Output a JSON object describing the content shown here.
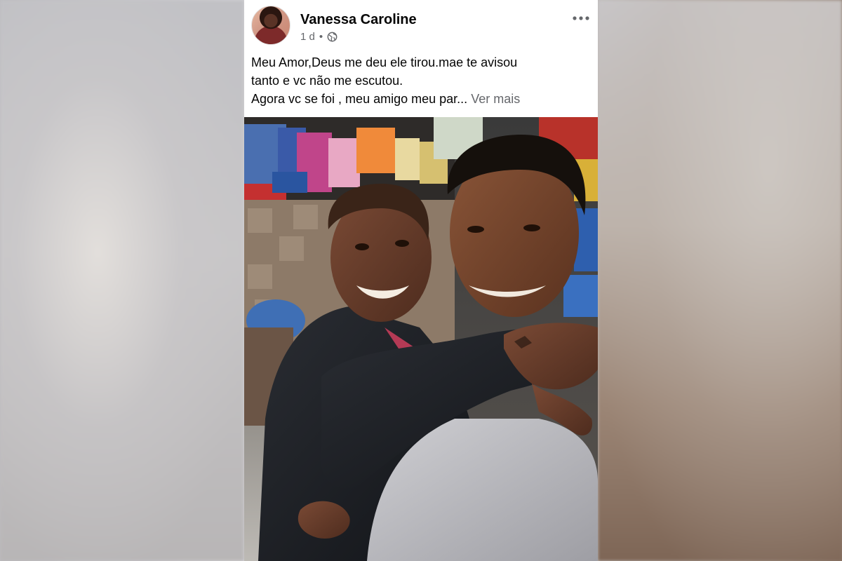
{
  "post": {
    "author": "Vanessa Caroline",
    "time": "1 d",
    "separator": "•",
    "privacy_icon": "globe-icon",
    "more_icon": "more-options-icon",
    "text_lines": [
      "Meu Amor,Deus me deu ele tirou.mae te avisou",
      "tanto e vc não me escutou.",
      "Agora vc se foi , meu amigo meu par"
    ],
    "ellipsis": "...",
    "see_more": "Ver mais",
    "photo_icon": "post-photo"
  },
  "colors": {
    "text": "#050505",
    "secondary": "#65676b",
    "card": "#ffffff"
  }
}
